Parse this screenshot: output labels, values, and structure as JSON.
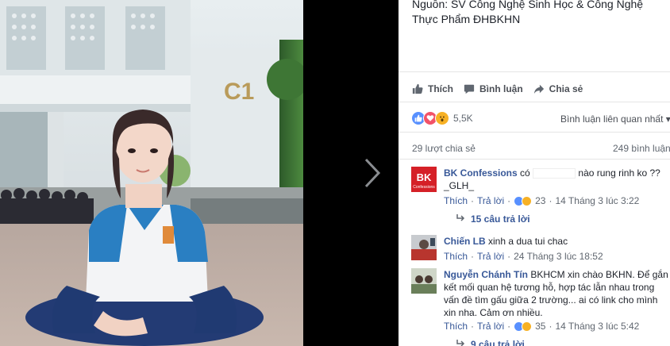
{
  "post": {
    "caption_line1": "Nguồn: SV Công Nghệ Sinh Học & Công Nghệ",
    "caption_line2": "Thực Phẩm ĐHBKHN"
  },
  "actions": {
    "like": "Thích",
    "comment": "Bình luận",
    "share": "Chia sẻ"
  },
  "reactions": {
    "count": "5,5K",
    "related": "Bình luận liên quan nhất ▾"
  },
  "stats": {
    "shares": "29 lượt chia sẻ",
    "comments": "249 bình luận"
  },
  "comments": [
    {
      "name": "BK Confessions",
      "text_pre": "có",
      "text_post": "nào rung rinh ko ?? _GLH_",
      "like": "Thích",
      "reply": "Trả lời",
      "reaction_count": "23",
      "time": "14 Tháng 3 lúc 3:22",
      "replies": "15 câu trả lời"
    },
    {
      "name": "Chiến LB",
      "text": "xinh a dua tui chac",
      "like": "Thích",
      "reply": "Trả lời",
      "time": "24 Tháng 3 lúc 18:52"
    },
    {
      "name": "Nguyễn Chánh Tín",
      "text": "BKHCM xin chào BKHN. Để gắn kết mối quan hệ tương hỗ, hợp tác lẫn nhau trong vấn đề tìm gấu giữa 2 trường... ai có link cho mình xin nha. Cảm ơn nhiều.",
      "like": "Thích",
      "reply": "Trả lời",
      "reaction_count": "35",
      "time": "14 Tháng 3 lúc 5:42",
      "replies": "9 câu trả lời"
    }
  ],
  "avatar_text": {
    "bk": "BK",
    "bk_sub": "Confessions"
  },
  "photo": {
    "building_label": "C1"
  },
  "colors": {
    "link": "#385898",
    "like_blue": "#5890ff",
    "love_red": "#f25268",
    "wow_yellow": "#f7b125"
  }
}
